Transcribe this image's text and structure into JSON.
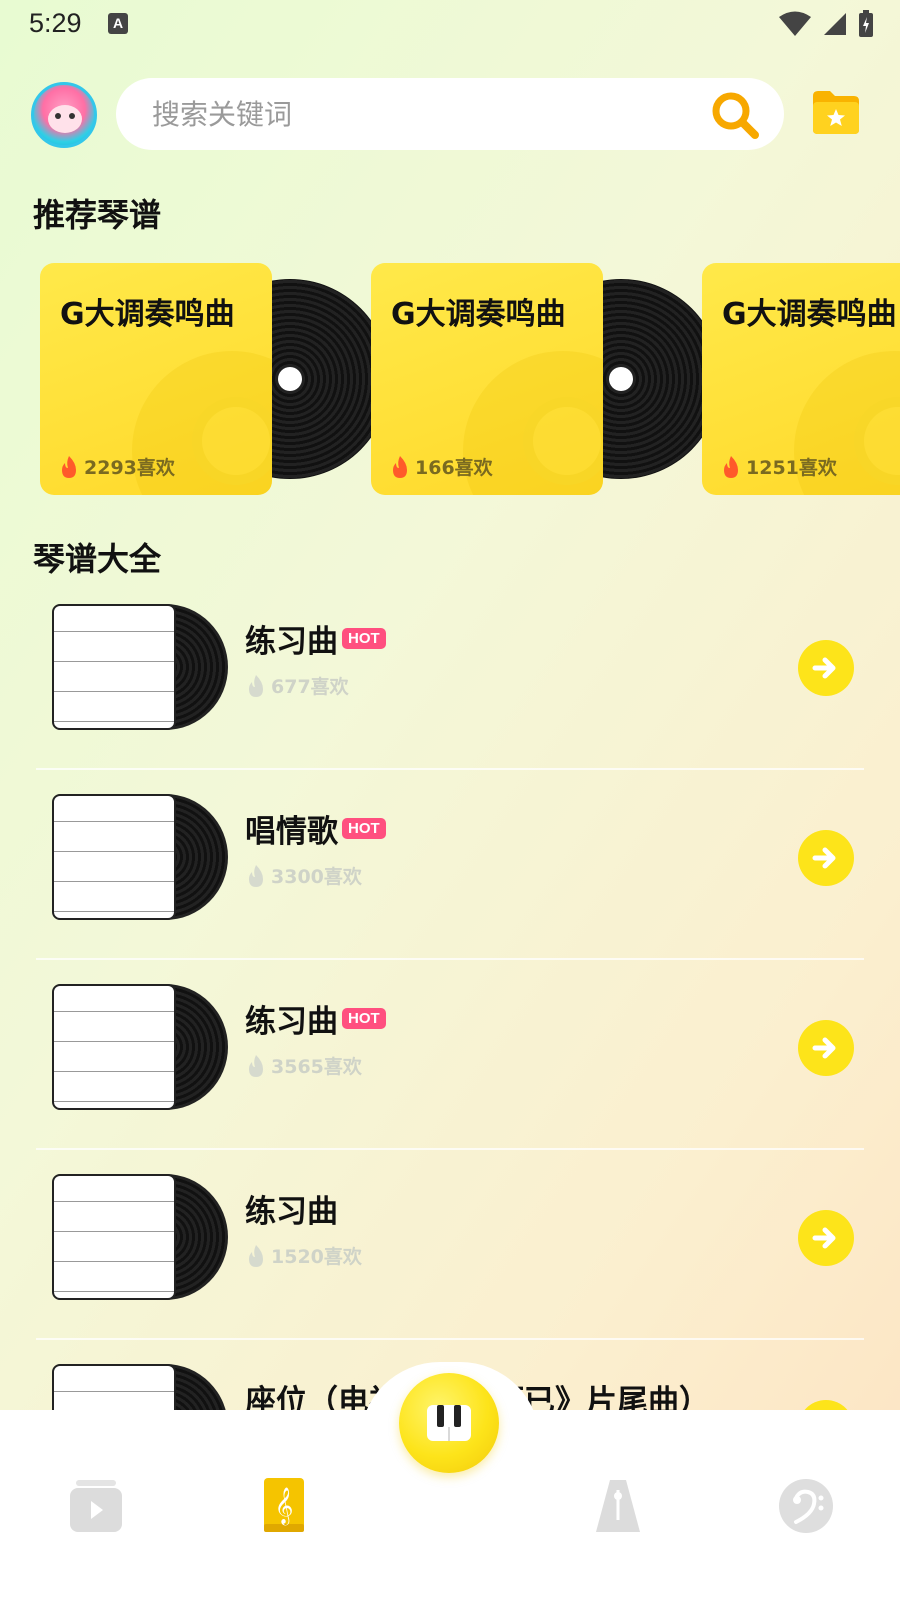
{
  "status_bar": {
    "time": "5:29",
    "a_icon": "A"
  },
  "header": {
    "search_placeholder": "搜索关键词"
  },
  "recommend": {
    "title": "推荐琴谱",
    "cards": [
      {
        "title": "G大调奏鸣曲",
        "likes": "2293喜欢"
      },
      {
        "title": "G大调奏鸣曲",
        "likes": "166喜欢"
      },
      {
        "title": "G大调奏鸣曲",
        "likes": "1251喜欢"
      }
    ]
  },
  "library": {
    "title": "琴谱大全",
    "items": [
      {
        "title": "练习曲",
        "hot": "HOT",
        "likes": "677喜欢"
      },
      {
        "title": "唱情歌",
        "hot": "HOT",
        "likes": "3300喜欢"
      },
      {
        "title": "练习曲",
        "hot": "HOT",
        "likes": "3565喜欢"
      },
      {
        "title": "练习曲",
        "hot": "",
        "likes": "1520喜欢"
      },
      {
        "title": "座位（电视剧《十而已》片尾曲）",
        "hot": "",
        "likes": ""
      }
    ]
  },
  "bottom_nav": {
    "items": [
      "video-icon",
      "sheet-music-icon",
      "metronome-icon",
      "bass-clef-icon"
    ],
    "active_color": "#f5c400"
  }
}
